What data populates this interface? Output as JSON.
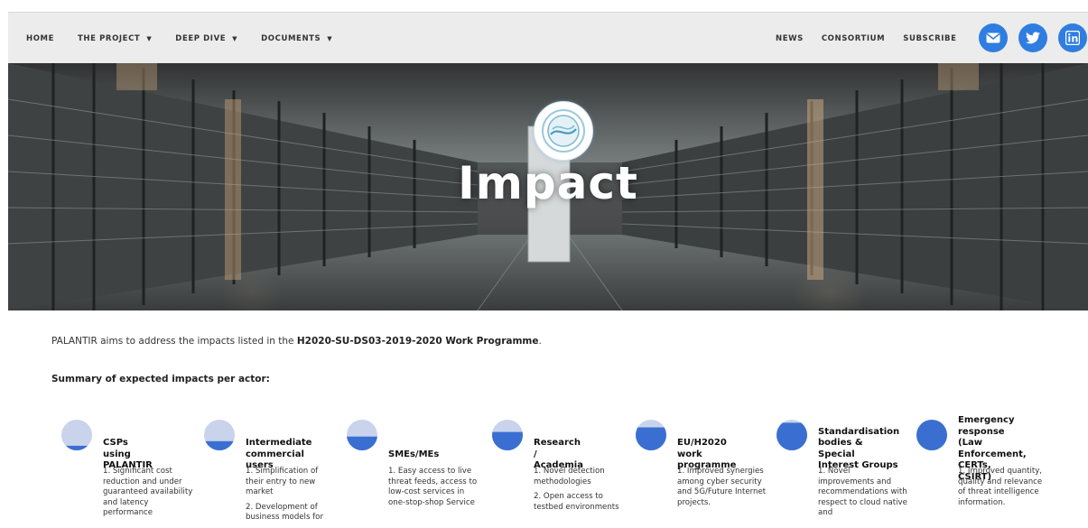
{
  "nav": {
    "left": [
      {
        "label": "HOME",
        "dropdown": false
      },
      {
        "label": "THE PROJECT",
        "dropdown": true
      },
      {
        "label": "DEEP DIVE",
        "dropdown": true
      },
      {
        "label": "DOCUMENTS",
        "dropdown": true
      }
    ],
    "right": [
      {
        "label": "NEWS"
      },
      {
        "label": "CONSORTIUM"
      },
      {
        "label": "SUBSCRIBE"
      }
    ],
    "caret": "▼",
    "social": [
      {
        "icon": "email-icon"
      },
      {
        "icon": "twitter-icon"
      },
      {
        "icon": "linkedin-icon"
      }
    ],
    "accent": "#2f7de1"
  },
  "hero": {
    "title": "Impact"
  },
  "intro": {
    "prefix": "PALANTIR aims to address the impacts listed in the ",
    "highlight": "H2020-SU-DS03-2019-2020 Work Programme",
    "suffix": "."
  },
  "summary": "Summary of expected impacts per actor:",
  "actors": [
    {
      "title_lines": [
        "CSPs using",
        "PALANTIR"
      ],
      "fill": 0.15,
      "items": [
        "1. Significant cost reduction and under guaranteed availability and latency performance"
      ]
    },
    {
      "title_lines": [
        "Intermediate",
        "commercial users"
      ],
      "fill": 0.3,
      "items": [
        "1. Simplification of their entry to new market",
        "2. Development of business models for"
      ]
    },
    {
      "title_lines": [
        "SMEs/MEs"
      ],
      "fill": 0.45,
      "items": [
        "1. Easy access to live threat feeds, access to low-cost services in one-stop-shop Service"
      ]
    },
    {
      "title_lines": [
        "Research /",
        "Academia"
      ],
      "fill": 0.6,
      "items": [
        "1. Novel detection methodologies",
        "2. Open access to testbed environments"
      ]
    },
    {
      "title_lines": [
        "EU/H2020 work",
        "programme"
      ],
      "fill": 0.75,
      "items": [
        "1. Improved synergies among cyber security and 5G/Future Internet projects."
      ]
    },
    {
      "title_lines": [
        "Standardisation",
        "bodies & Special",
        "Interest Groups"
      ],
      "fill": 0.9,
      "items": [
        "1. Novel improvements and recommendations with respect to cloud native and"
      ]
    },
    {
      "title_lines": [
        "Emergency",
        "response (Law",
        "Enforcement,",
        "CERTs, CSIRT)"
      ],
      "fill": 1.0,
      "items": [
        "1. Improved quantity, quality and relevance of threat intelligence information."
      ]
    }
  ],
  "colors": {
    "pie_full": "#3a6fd1",
    "pie_empty": "#c9d3ec"
  }
}
